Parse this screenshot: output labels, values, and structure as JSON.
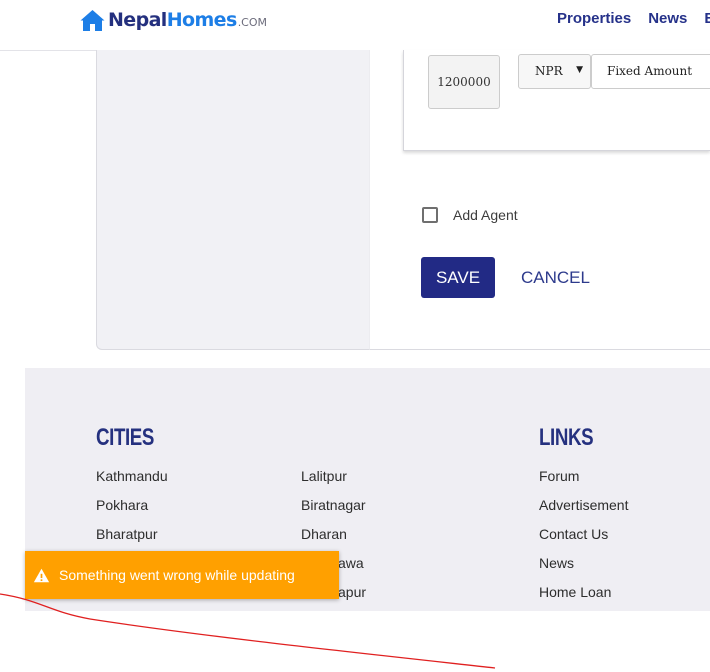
{
  "header": {
    "logo": {
      "brand_part1": "Nepal",
      "brand_part2": "Homes",
      "domain": ".COM"
    },
    "nav": [
      "Properties",
      "News",
      "E"
    ]
  },
  "form": {
    "price_amount": "1200000",
    "currency": "NPR",
    "price_type": "Fixed Amount",
    "add_agent_label": "Add Agent",
    "save_label": "SAVE",
    "cancel_label": "CANCEL"
  },
  "footer": {
    "cities_heading": "CITIES",
    "cities_col1": [
      "Kathmandu",
      "Pokhara",
      "Bharatpur",
      "",
      ""
    ],
    "cities_col2": [
      "Lalitpur",
      "Biratnagar",
      "Dharan",
      "awa",
      "apur"
    ],
    "links_heading": "LINKS",
    "links": [
      "Forum",
      "Advertisement",
      "Contact Us",
      "News",
      "Home Loan"
    ]
  },
  "toast": {
    "message": "Something went wrong while updating",
    "icon": "warning-icon",
    "color": "#ffa000"
  },
  "colors": {
    "brand_navy": "#24307e",
    "brand_blue": "#1d7ee6",
    "save_button": "#222a85",
    "footer_bg": "#efeef3",
    "annotation_line": "#e02020"
  }
}
